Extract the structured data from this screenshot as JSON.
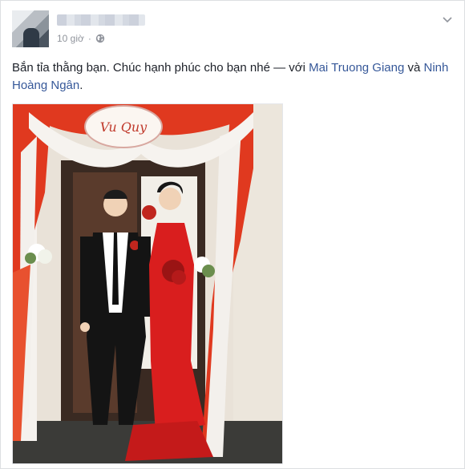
{
  "post": {
    "timestamp": "10 giờ",
    "separator": "·",
    "privacy_icon": "globe-icon",
    "menu_icon": "chevron-down-icon",
    "text_main": "Bắn tỉa thằng bạn. Chúc hạnh phúc cho bạn nhé",
    "text_with": " — với ",
    "tag_1": "Mai Truong Giang",
    "text_and": " và ",
    "tag_2": "Ninh Hoàng Ngân",
    "text_end": "."
  },
  "photo": {
    "sign_text": "Vu Quy"
  },
  "colors": {
    "link": "#365899",
    "meta": "#90949c",
    "drape_red": "#e0391f",
    "ao_dai_red": "#d91e1e"
  }
}
